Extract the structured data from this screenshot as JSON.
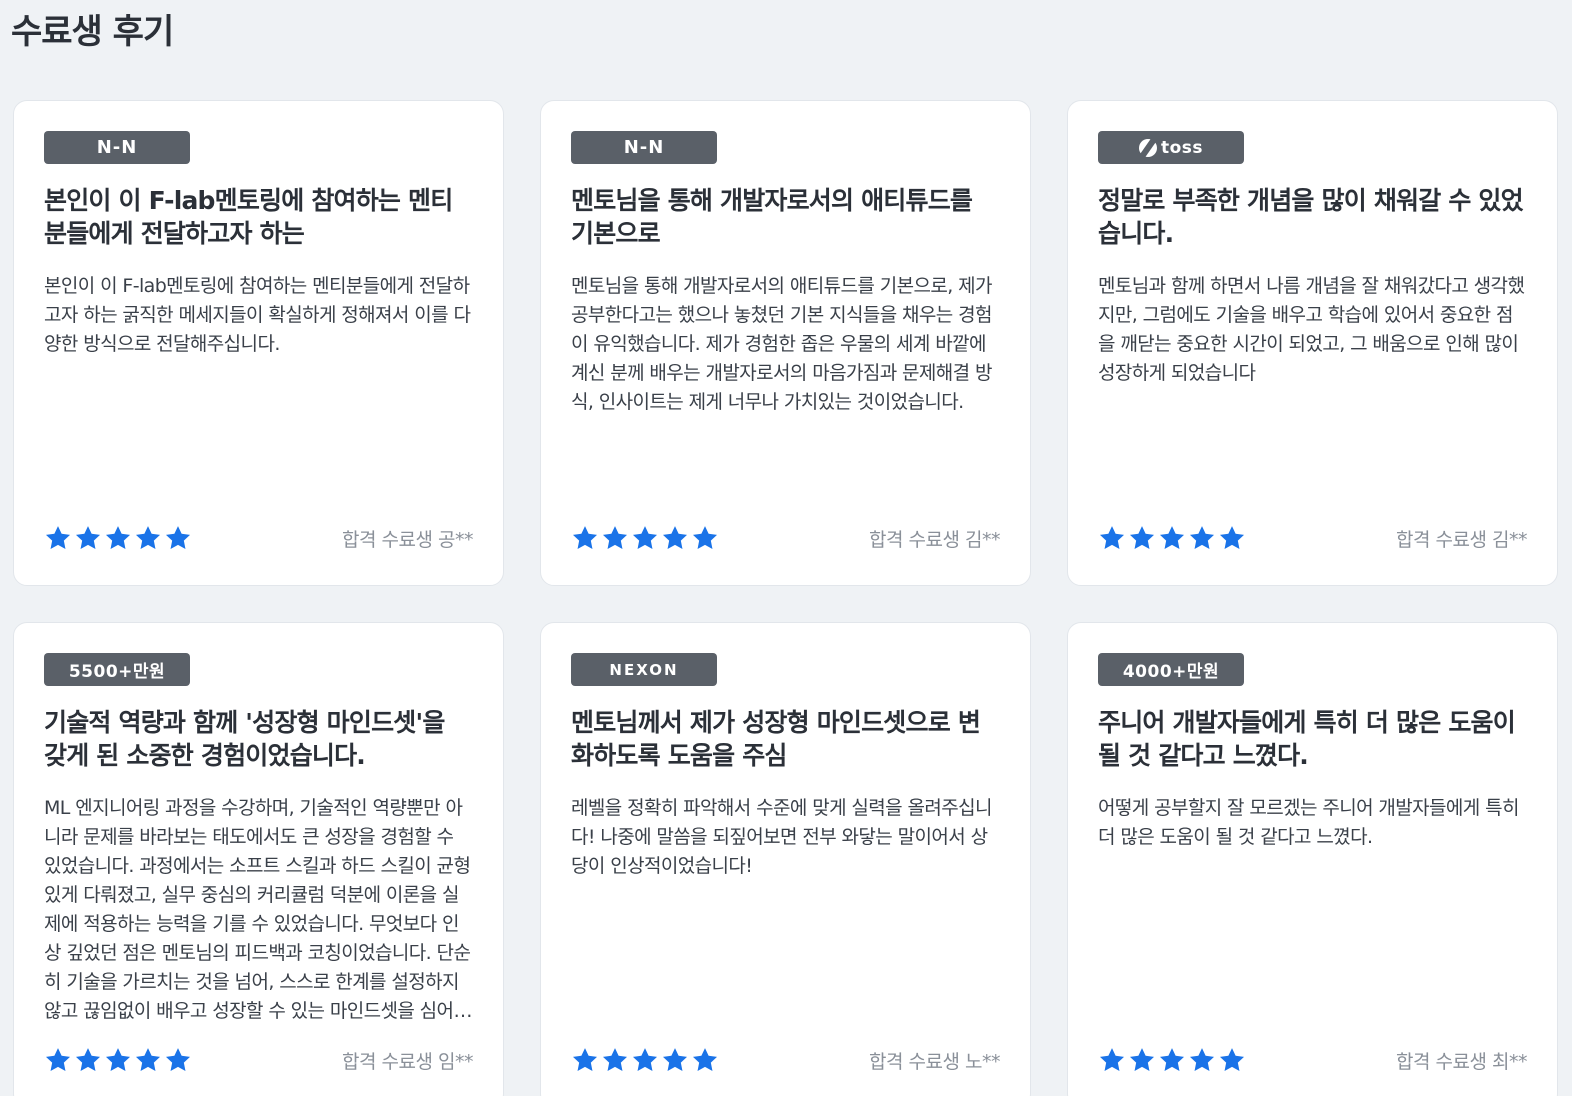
{
  "section": {
    "title": "수료생 후기"
  },
  "colors": {
    "star": "#1a73e8",
    "badge_bg": "#5a6068",
    "page_bg": "#eff2f5"
  },
  "reviews": [
    {
      "badge": "N-N",
      "badge_type": "nhn",
      "badge_icon": "nhn-logo-icon",
      "title": "본인이 이 F-lab멘토링에 참여하는 멘티분들에게 전달하고자 하는",
      "body": "본인이 이 F-lab멘토링에 참여하는 멘티분들에게 전달하고자 하는 굵직한 메세지들이 확실하게 정해져서 이를 다양한 방식으로 전달해주십니다.",
      "rating": 5,
      "reviewer": "합격 수료생 공**"
    },
    {
      "badge": "N-N",
      "badge_type": "nhn",
      "badge_icon": "nhn-logo-icon",
      "title": "멘토님을 통해 개발자로서의 애티튜드를 기본으로",
      "body": "멘토님을 통해 개발자로서의 애티튜드를 기본으로, 제가 공부한다고는 했으나 놓쳤던 기본 지식들을 채우는 경험이 유익했습니다. 제가 경험한 좁은 우물의 세계 바깥에 계신 분께 배우는 개발자로서의 마음가짐과 문제해결 방식, 인사이트는 제게 너무나 가치있는 것이었습니다.",
      "rating": 5,
      "reviewer": "합격 수료생 김**"
    },
    {
      "badge": "toss",
      "badge_type": "toss",
      "badge_icon": "toss-logo-icon",
      "title": "정말로 부족한 개념을 많이 채워갈 수 있었습니다.",
      "body": "멘토님과 함께 하면서 나름 개념을 잘 채워갔다고 생각했지만, 그럼에도 기술을 배우고 학습에 있어서 중요한 점을 깨닫는 중요한 시간이 되었고, 그 배움으로 인해 많이 성장하게 되었습니다",
      "rating": 5,
      "reviewer": "합격 수료생 김**"
    },
    {
      "badge": "5500+만원",
      "badge_type": "salary",
      "badge_icon": "",
      "title": "기술적 역량과 함께 '성장형 마인드셋'을 갖게 된 소중한 경험이었습니다.",
      "body": "ML 엔지니어링 과정을 수강하며, 기술적인 역량뿐만 아니라 문제를 바라보는 태도에서도 큰 성장을 경험할 수 있었습니다. 과정에서는 소프트 스킬과 하드 스킬이 균형 있게 다뤄졌고, 실무 중심의 커리큘럼 덕분에 이론을 실제에 적용하는 능력을 기를 수 있었습니다. 무엇보다 인상 깊었던 점은 멘토님의 피드백과 코칭이었습니다. 단순히 기술을 가르치는 것을 넘어, 스스로 한계를 설정하지 않고 끊임없이 배우고 성장할 수 있는 마인드셋을 심어주셨습니다.",
      "rating": 5,
      "reviewer": "합격 수료생 임**"
    },
    {
      "badge": "NEXON",
      "badge_type": "nexon",
      "badge_icon": "nexon-logo-icon",
      "title": "멘토님께서 제가 성장형 마인드셋으로 변화하도록 도움을 주심",
      "body": "레벨을 정확히 파악해서 수준에 맞게 실력을 올려주십니다! 나중에 말씀을 되짚어보면 전부 와닿는 말이어서 상당이 인상적이었습니다!",
      "rating": 5,
      "reviewer": "합격 수료생 노**"
    },
    {
      "badge": "4000+만원",
      "badge_type": "salary",
      "badge_icon": "",
      "title": "주니어 개발자들에게 특히 더 많은 도움이 될 것 같다고 느꼈다.",
      "body": "어떻게 공부할지 잘 모르겠는 주니어 개발자들에게 특히 더 많은 도움이 될 것 같다고 느꼈다.",
      "rating": 5,
      "reviewer": "합격 수료생 최**"
    }
  ]
}
